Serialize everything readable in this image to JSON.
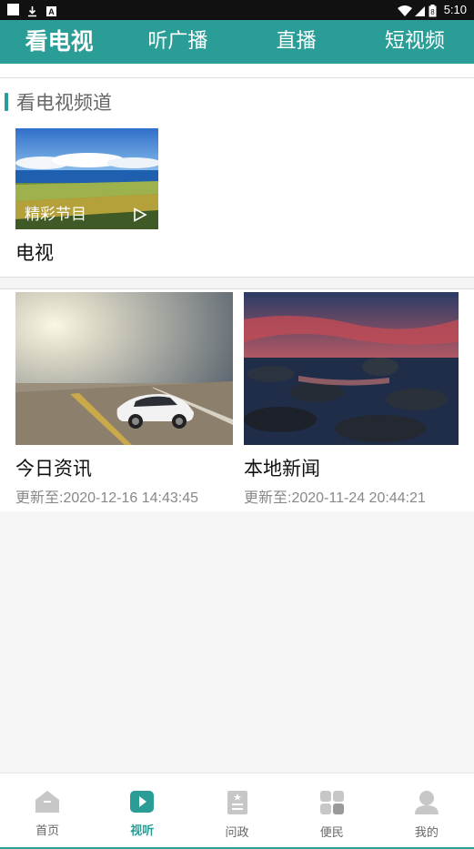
{
  "status_bar": {
    "time": "5:10"
  },
  "top_nav": {
    "tabs": [
      {
        "label": "看电视",
        "active": true
      },
      {
        "label": "听广播",
        "active": false
      },
      {
        "label": "直播",
        "active": false
      },
      {
        "label": "短视频",
        "active": false
      }
    ]
  },
  "tv_section": {
    "title": "看电视频道",
    "card": {
      "overlay_text": "精彩节目",
      "label": "电视"
    }
  },
  "news": [
    {
      "title": "今日资讯",
      "updated": "更新至:2020-12-16 14:43:45"
    },
    {
      "title": "本地新闻",
      "updated": "更新至:2020-11-24 20:44:21"
    }
  ],
  "bottom_nav": {
    "items": [
      {
        "label": "首页",
        "icon": "home-icon",
        "active": false
      },
      {
        "label": "视听",
        "icon": "play-icon",
        "active": true
      },
      {
        "label": "问政",
        "icon": "document-icon",
        "active": false
      },
      {
        "label": "便民",
        "icon": "grid-icon",
        "active": false
      },
      {
        "label": "我的",
        "icon": "user-icon",
        "active": false
      }
    ]
  },
  "colors": {
    "accent": "#2a9d96"
  }
}
